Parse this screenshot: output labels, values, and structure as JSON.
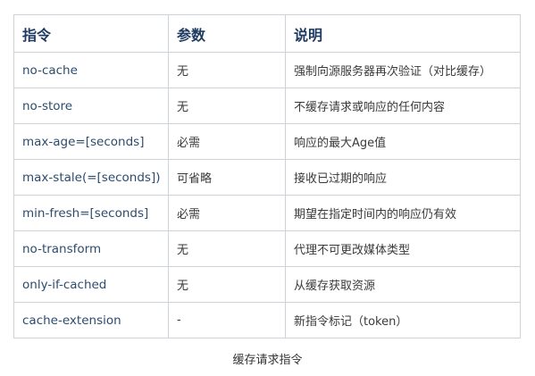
{
  "table": {
    "headers": [
      "指令",
      "参数",
      "说明"
    ],
    "rows": [
      [
        "no-cache",
        "无",
        "强制向源服务器再次验证（对比缓存）"
      ],
      [
        "no-store",
        "无",
        "不缓存请求或响应的任何内容"
      ],
      [
        "max-age=[seconds]",
        "必需",
        "响应的最大Age值"
      ],
      [
        "max-stale(=[seconds])",
        "可省略",
        "接收已过期的响应"
      ],
      [
        "min-fresh=[seconds]",
        "必需",
        "期望在指定时间内的响应仍有效"
      ],
      [
        "no-transform",
        "无",
        "代理不可更改媒体类型"
      ],
      [
        "only-if-cached",
        "无",
        "从缓存获取资源"
      ],
      [
        "cache-extension",
        "-",
        "新指令标记（token）"
      ]
    ]
  },
  "caption": "缓存请求指令"
}
